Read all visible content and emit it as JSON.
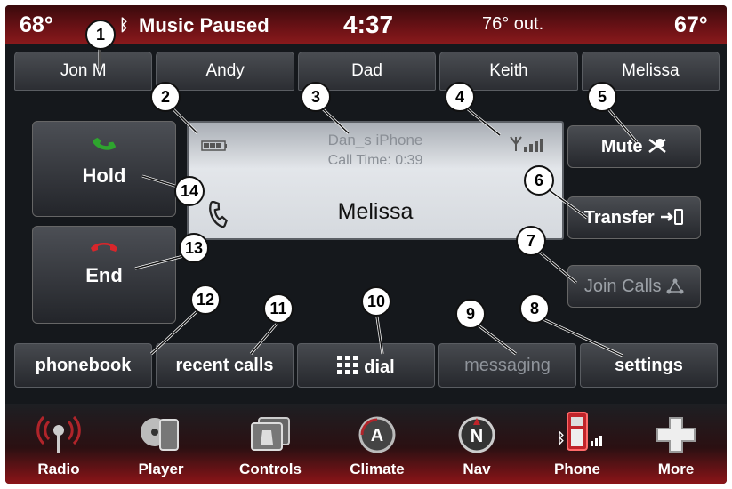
{
  "status": {
    "temp_left": "68°",
    "music": "Music Paused",
    "clock": "4:37",
    "outside": "76° out.",
    "temp_right": "67°"
  },
  "speed_dial": [
    "Jon M",
    "Andy",
    "Dad",
    "Keith",
    "Melissa"
  ],
  "hold": {
    "label": "Hold"
  },
  "end": {
    "label": "End"
  },
  "call": {
    "device": "Dan_s iPhone",
    "time": "Call Time: 0:39",
    "caller": "Melissa"
  },
  "right_buttons": {
    "mute": "Mute",
    "transfer": "Transfer",
    "join": "Join Calls"
  },
  "functions": [
    "phonebook",
    "recent calls",
    "dial",
    "messaging",
    "settings"
  ],
  "nav": [
    "Radio",
    "Player",
    "Controls",
    "Climate",
    "Nav",
    "Phone",
    "More"
  ],
  "callouts": [
    "1",
    "2",
    "3",
    "4",
    "5",
    "6",
    "7",
    "8",
    "9",
    "10",
    "11",
    "12",
    "13",
    "14"
  ],
  "colors": {
    "accent_red": "#8a1a1c",
    "green_phone": "#2ea52e",
    "red_phone": "#d8262b"
  }
}
